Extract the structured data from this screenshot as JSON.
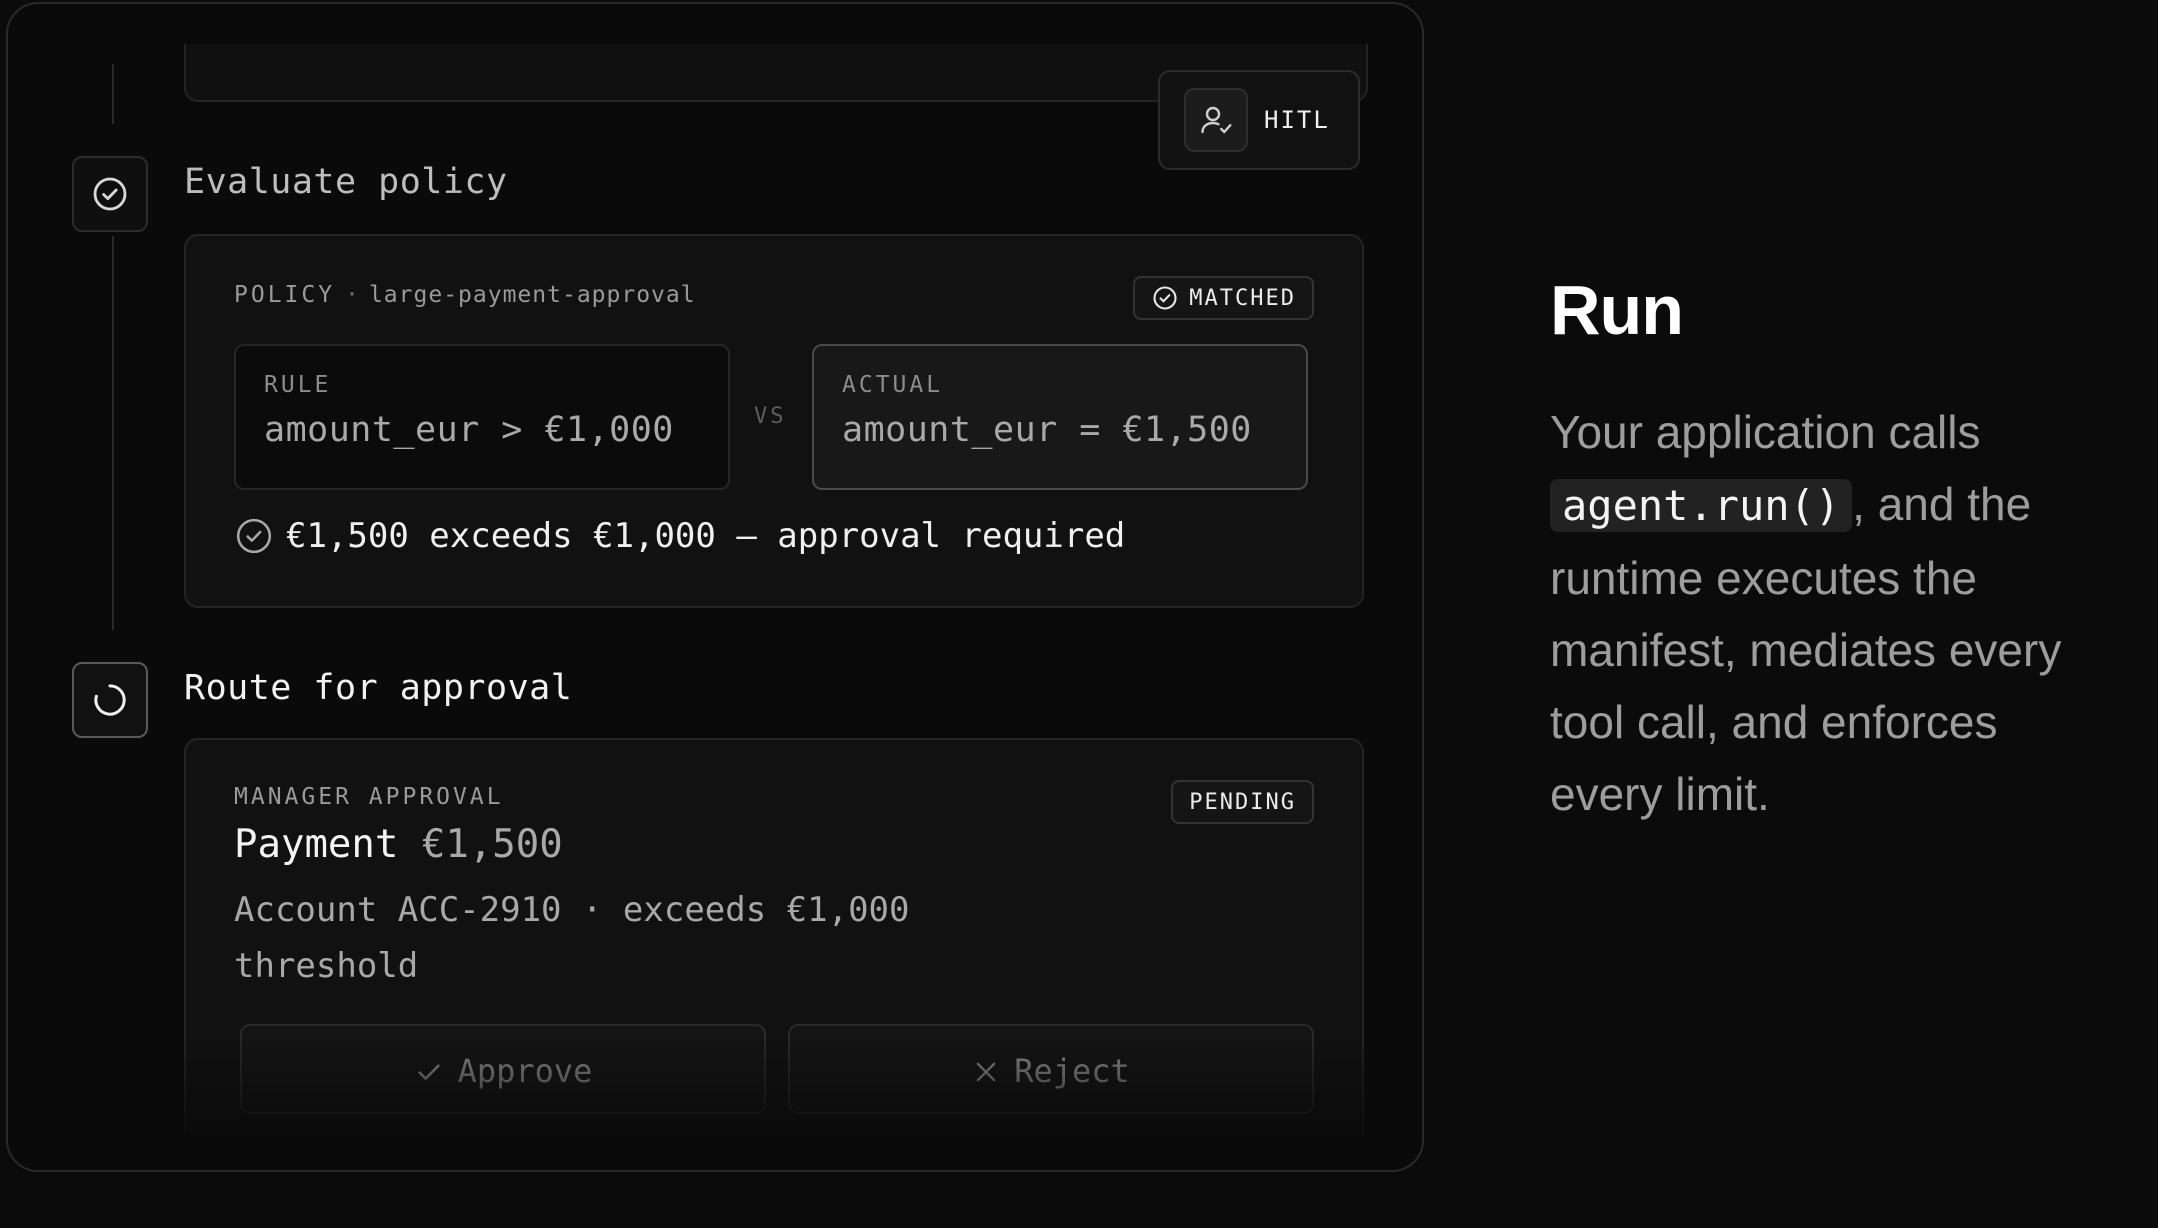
{
  "badge_hitl": "HITL",
  "steps": {
    "evaluate": {
      "title": "Evaluate policy",
      "policy_label": "POLICY",
      "separator": "·",
      "policy_name": "large-payment-approval",
      "status": "MATCHED",
      "rule_label": "RULE",
      "rule_value": "amount_eur > €1,000",
      "vs": "VS",
      "actual_label": "ACTUAL",
      "actual_value": "amount_eur = €1,500",
      "result": "€1,500 exceeds €1,000 — approval required"
    },
    "route": {
      "title": "Route for approval",
      "overline": "MANAGER APPROVAL",
      "status": "PENDING",
      "payment_label": "Payment",
      "payment_amount": "€1,500",
      "description": "Account ACC-2910 · exceeds €1,000 threshold",
      "approve_label": "Approve",
      "reject_label": "Reject"
    }
  },
  "copy": {
    "title": "Run",
    "body_before": "Your application calls ",
    "code": "agent.run()",
    "body_after": ", and the runtime executes the manifest, mediates every tool call, and enforces every limit."
  },
  "icons": {
    "hitl": "user-check-icon",
    "step_done": "check-circle-icon",
    "step_running": "spinner-icon",
    "matched": "check-circle-icon",
    "result": "check-circle-icon",
    "approve": "check-icon",
    "reject": "x-icon"
  }
}
